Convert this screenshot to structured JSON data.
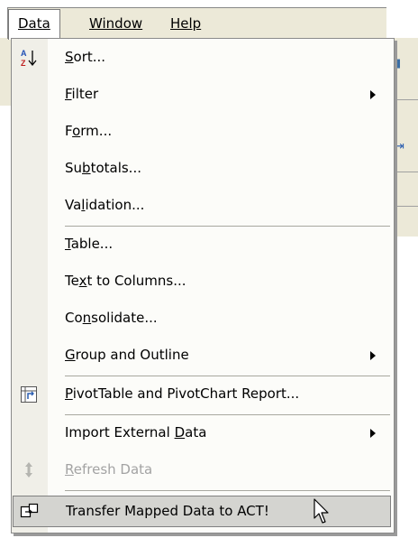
{
  "menubar": {
    "items": [
      {
        "label": "Data",
        "active": true
      },
      {
        "label": "Window",
        "active": false
      },
      {
        "label": "Help",
        "active": false
      }
    ]
  },
  "menu": {
    "items": [
      {
        "pre": "",
        "key": "S",
        "post": "ort...",
        "icon": "sort-ascending-icon",
        "submenu": false,
        "disabled": false
      },
      {
        "pre": "",
        "key": "F",
        "post": "ilter",
        "icon": null,
        "submenu": true,
        "disabled": false
      },
      {
        "pre": "F",
        "key": "o",
        "post": "rm...",
        "icon": null,
        "submenu": false,
        "disabled": false
      },
      {
        "pre": "Su",
        "key": "b",
        "post": "totals...",
        "icon": null,
        "submenu": false,
        "disabled": false
      },
      {
        "pre": "Va",
        "key": "l",
        "post": "idation...",
        "icon": null,
        "submenu": false,
        "disabled": false
      },
      {
        "pre": "",
        "key": "T",
        "post": "able...",
        "icon": null,
        "submenu": false,
        "disabled": false
      },
      {
        "pre": "Te",
        "key": "x",
        "post": "t to Columns...",
        "icon": null,
        "submenu": false,
        "disabled": false
      },
      {
        "pre": "Co",
        "key": "n",
        "post": "solidate...",
        "icon": null,
        "submenu": false,
        "disabled": false
      },
      {
        "pre": "",
        "key": "G",
        "post": "roup and Outline",
        "icon": null,
        "submenu": true,
        "disabled": false
      },
      {
        "pre": "",
        "key": "P",
        "post": "ivotTable and PivotChart Report...",
        "icon": "pivottable-icon",
        "submenu": false,
        "disabled": false
      },
      {
        "pre": "Import External ",
        "key": "D",
        "post": "ata",
        "icon": null,
        "submenu": true,
        "disabled": false
      },
      {
        "pre": "",
        "key": "R",
        "post": "efresh Data",
        "icon": "refresh-icon",
        "submenu": false,
        "disabled": true
      },
      {
        "pre": "Transfer Mapped Data to ACT!",
        "key": "",
        "post": "",
        "icon": "transfer-mapped-data-icon",
        "submenu": false,
        "disabled": false,
        "highlighted": true
      }
    ]
  },
  "colors": {
    "menubar_bg": "#ece9d8",
    "menu_bg": "#fcfcf9",
    "highlight_bg": "#d4d4d0",
    "disabled_text": "#a3a3a3"
  }
}
